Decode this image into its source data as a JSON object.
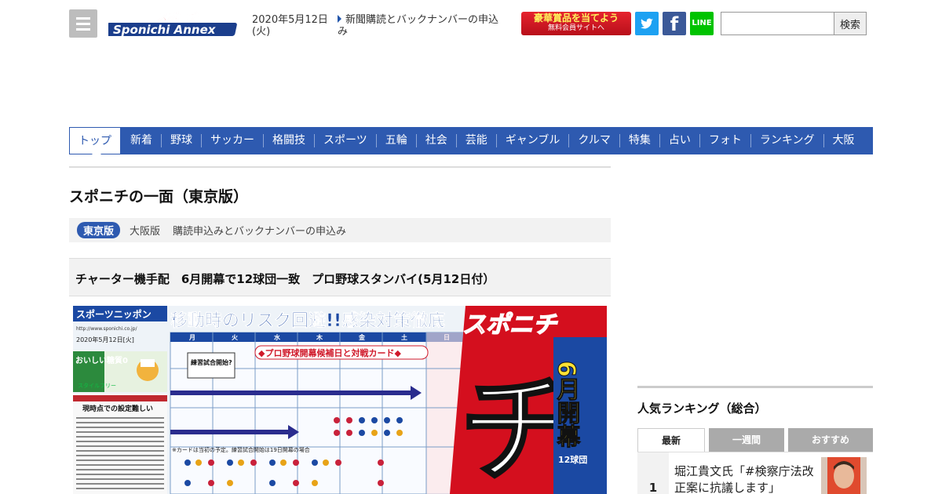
{
  "header": {
    "logo_top": "スポニチ",
    "logo_main": "Sponichi Annex",
    "date_line1": "2020年5月12日",
    "date_line2": "(火)",
    "news_link": "新聞購読とバックナンバーの申込み",
    "prize_line1": "豪華賞品を当てよう",
    "prize_line2": "無料会員サイトへ",
    "line_label": "LINE",
    "fb_label": "f",
    "search_value": "",
    "search_button": "検索"
  },
  "nav": {
    "items": [
      "トップ",
      "新着",
      "野球",
      "サッカー",
      "格闘技",
      "スポーツ",
      "五輪",
      "社会",
      "芸能",
      "ギャンブル",
      "クルマ",
      "特集",
      "占い",
      "フォト",
      "ランキング",
      "大阪"
    ]
  },
  "main": {
    "page_title": "スポニチの一面（東京版）",
    "edition_active": "東京版",
    "edition_other": "大阪版",
    "subscribe_link": "購読申込みとバックナンバーの申込み",
    "article_title": "チャーター機手配　6月開幕で12球団一致　プロ野球スタンバイ(5月12日付）"
  },
  "front_page": {
    "masthead": "スポーツニッポン",
    "headline": "移動時のリスク回避!!感染対策徹底",
    "brand": "スポニチ",
    "big_char": "チ",
    "vertical_a": "6月開幕",
    "vertical_b": "12球団",
    "date_text": "2020年5月12日[火]",
    "ad_text": "おいしい糖質0",
    "ad_small": "スタイルフリー",
    "schedule_banner": "◆プロ野球開幕候補日と対戦カード◆",
    "practice_label": "練習試合開始?",
    "weekdays": [
      "月",
      "火",
      "水",
      "木",
      "金",
      "土",
      "日"
    ],
    "note": "※カードは当初の予定。練習試合開始は19日開幕の場合",
    "side_note": "現時点での設定難しい",
    "url": "http://www.sponichi.co.jp/"
  },
  "sidebar": {
    "ranking_title": "人気ランキング（総合）",
    "tabs": [
      "最新",
      "一週間",
      "おすすめ"
    ],
    "rank_num": "1",
    "rank_text": "堀江貴文氏「#検察庁法改正案に抗議します」"
  },
  "colors": {
    "nav_blue": "#2e5ab0",
    "prize_red": "#d81e28",
    "twitter": "#1da1f2",
    "facebook": "#3b5998",
    "line": "#00c300"
  }
}
